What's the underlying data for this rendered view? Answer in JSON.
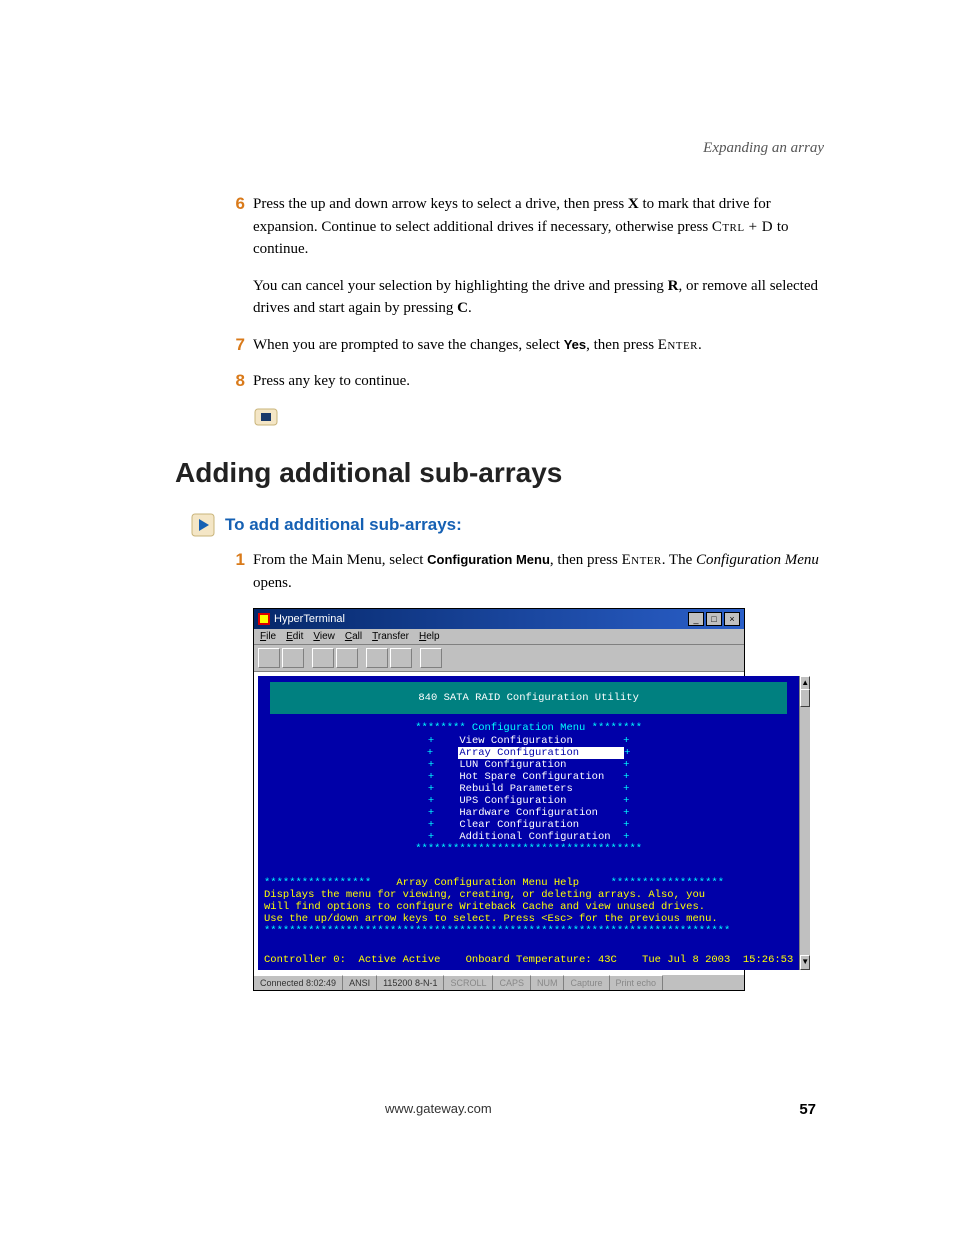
{
  "header": {
    "section_label": "Expanding an array"
  },
  "steps_a": [
    {
      "num": "6",
      "parts": [
        {
          "t": "Press the up and down arrow keys to select a drive, then press "
        },
        {
          "t": "X",
          "bold": true
        },
        {
          "t": " to mark that drive for expansion. Continue to select additional drives if necessary, otherwise press "
        },
        {
          "t": "Ctrl + D",
          "sc": true
        },
        {
          "t": " to continue."
        }
      ]
    },
    {
      "extra": [
        {
          "t": "You can cancel your selection by highlighting the drive and pressing "
        },
        {
          "t": "R",
          "bold": true
        },
        {
          "t": ", or remove all selected drives and start again by pressing "
        },
        {
          "t": "C",
          "bold": true
        },
        {
          "t": "."
        }
      ]
    },
    {
      "num": "7",
      "parts": [
        {
          "t": "When you are prompted to save the changes, select "
        },
        {
          "t": "Yes",
          "sans": true
        },
        {
          "t": ", then press "
        },
        {
          "t": "Enter",
          "sc": true
        },
        {
          "t": "."
        }
      ]
    },
    {
      "num": "8",
      "parts": [
        {
          "t": "Press any key to continue."
        }
      ]
    }
  ],
  "section_title": "Adding additional sub-arrays",
  "sub_head": "To add additional sub-arrays:",
  "steps_b": [
    {
      "num": "1",
      "parts": [
        {
          "t": "From the Main Menu, select "
        },
        {
          "t": "Configuration Menu",
          "sans": true
        },
        {
          "t": ", then press "
        },
        {
          "t": "Enter",
          "sc": true
        },
        {
          "t": ". The "
        },
        {
          "t": "Configuration Menu",
          "italic": true
        },
        {
          "t": " opens."
        }
      ]
    }
  ],
  "screenshot": {
    "title": "HyperTerminal",
    "menus": [
      "File",
      "Edit",
      "View",
      "Call",
      "Transfer",
      "Help"
    ],
    "toolbar_buttons": 7,
    "utility_title": "840 SATA RAID Configuration Utility",
    "menu_header": "******** Configuration Menu ********",
    "menu_items": [
      {
        "label": "View Configuration"
      },
      {
        "label": "Array Configuration",
        "selected": true
      },
      {
        "label": "LUN Configuration"
      },
      {
        "label": "Hot Spare Configuration"
      },
      {
        "label": "Rebuild Parameters"
      },
      {
        "label": "UPS Configuration"
      },
      {
        "label": "Hardware Configuration"
      },
      {
        "label": "Clear Configuration"
      },
      {
        "label": "Additional Configuration"
      }
    ],
    "menu_footer": "************************************",
    "help_title_left": "*****************",
    "help_title": "Array Configuration Menu Help",
    "help_title_right": "******************",
    "help_lines": [
      "Displays the menu for viewing, creating, or deleting arrays. Also, you",
      "will find options to configure Writeback Cache and view unused drives.",
      "Use the up/down arrow keys to select. Press <Esc> for the previous menu."
    ],
    "help_footer": "**************************************************************************",
    "controller_line": "Controller 0:  Active Active    Onboard Temperature: 43C    Tue Jul 8 2003  15:26:53",
    "status": {
      "conn": "Connected 8:02:49",
      "emul": "ANSI",
      "port": "115200 8-N-1",
      "cells": [
        "SCROLL",
        "CAPS",
        "NUM",
        "Capture",
        "Print echo"
      ]
    }
  },
  "footer": {
    "url": "www.gateway.com",
    "page": "57"
  }
}
